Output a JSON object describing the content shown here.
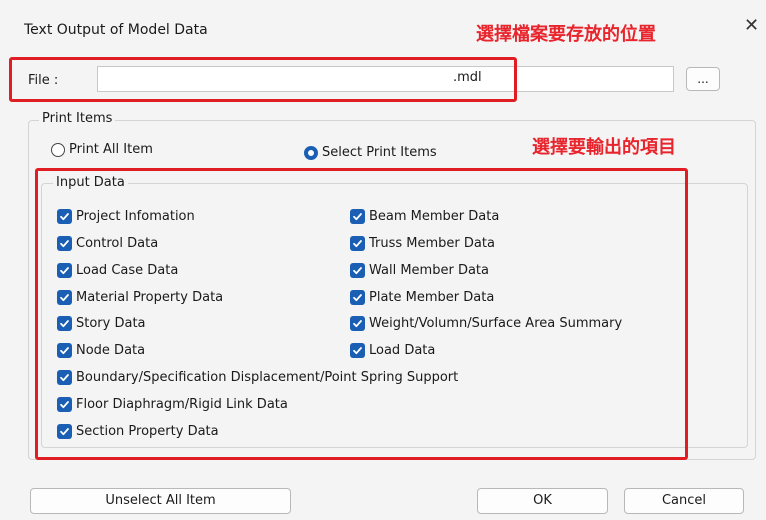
{
  "window": {
    "title": "Text Output of Model Data",
    "close_glyph": "✕"
  },
  "annotations": {
    "file_note": "選擇檔案要存放的位置",
    "items_note": "選擇要輸出的項目",
    "highlight_color": "#e11d24"
  },
  "file": {
    "label": "File :",
    "value": ".mdl",
    "browse_label": "..."
  },
  "print_items": {
    "legend": "Print Items",
    "options": [
      {
        "label": "Print All Item",
        "selected": false
      },
      {
        "label": "Select Print Items",
        "selected": true
      }
    ]
  },
  "input_data": {
    "legend": "Input Data",
    "items": [
      {
        "label": "Project Infomation",
        "checked": true
      },
      {
        "label": "Control Data",
        "checked": true
      },
      {
        "label": "Load Case Data",
        "checked": true
      },
      {
        "label": "Material Property Data",
        "checked": true
      },
      {
        "label": "Story Data",
        "checked": true
      },
      {
        "label": "Node Data",
        "checked": true
      },
      {
        "label": "Boundary/Specification Displacement/Point Spring Support",
        "checked": true
      },
      {
        "label": "Floor Diaphragm/Rigid Link Data",
        "checked": true
      },
      {
        "label": "Section Property Data",
        "checked": true
      },
      {
        "label": "Beam Member Data",
        "checked": true
      },
      {
        "label": "Truss Member Data",
        "checked": true
      },
      {
        "label": "Wall Member Data",
        "checked": true
      },
      {
        "label": "Plate Member Data",
        "checked": true
      },
      {
        "label": "Weight/Volumn/Surface Area Summary",
        "checked": true
      },
      {
        "label": "Load Data",
        "checked": true
      }
    ]
  },
  "buttons": {
    "unselect_all": "Unselect All Item",
    "ok": "OK",
    "cancel": "Cancel"
  },
  "colors": {
    "accent": "#1a5fb4"
  }
}
